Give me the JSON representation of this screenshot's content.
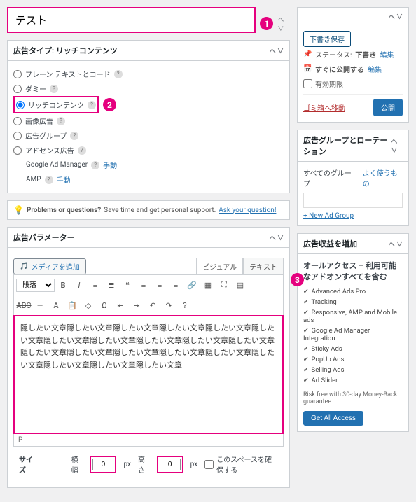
{
  "title_value": "テスト",
  "ad_type": {
    "header": "広告タイプ: リッチコンテンツ",
    "options": [
      {
        "label": "プレーン テキストとコード",
        "link": ""
      },
      {
        "label": "ダミー",
        "link": ""
      },
      {
        "label": "リッチコンテンツ",
        "link": ""
      },
      {
        "label": "画像広告",
        "link": ""
      },
      {
        "label": "広告グループ",
        "link": ""
      },
      {
        "label": "アドセンス広告",
        "link": ""
      },
      {
        "label": "Google Ad Manager",
        "link": "手動"
      },
      {
        "label": "AMP",
        "link": "手動"
      }
    ]
  },
  "tip": {
    "bold": "Problems or questions?",
    "text": " Save time and get personal support. ",
    "link": "Ask your question!"
  },
  "params": {
    "header": "広告パラメーター",
    "media_btn": "メディアを追加",
    "tab_visual": "ビジュアル",
    "tab_text": "テキスト",
    "format_sel": "段落",
    "content": "隠したい文章隠したい文章隠したい文章隠したい文章隠したい文章隠したい文章隠したい文章隠したい文章隠したい文章隠したい文章隠したい文章隠したい文章隠したい文章隠したい文章隠したい文章隠したい文章隠したい文章隠したい文章隠したい文章隠したい文章",
    "path": "P"
  },
  "size": {
    "label": "サイズ",
    "width_label": "横幅",
    "width": "0",
    "height_label": "高さ",
    "height": "0",
    "unit": "px",
    "reserve": "このスペースを確保する"
  },
  "publish": {
    "save_draft": "下書き保存",
    "status_label": "ステータス:",
    "status_value": "下書き",
    "status_edit": "編集",
    "schedule_label": "すぐに公開する",
    "schedule_edit": "編集",
    "expiry": "有効期限",
    "trash": "ゴミ箱へ移動",
    "publish_btn": "公開"
  },
  "groups": {
    "header": "広告グループとローテーション",
    "all": "すべてのグループ",
    "fav": "よく使うもの",
    "new": "+ New Ad Group"
  },
  "revenue": {
    "header": "広告収益を増加",
    "subhead": "オールアクセス – 利用可能なアドオンすべてを含む",
    "features": [
      "Advanced Ads Pro",
      "Tracking",
      "Responsive, AMP and Mobile ads",
      "Google Ad Manager Integration",
      "Sticky Ads",
      "PopUp Ads",
      "Selling Ads",
      "Ad Slider"
    ],
    "guarantee": "Risk free with 30-day Money-Back guarantee",
    "cta": "Get All Access"
  },
  "callouts": {
    "c1": "1",
    "c2": "2",
    "c3": "3"
  }
}
